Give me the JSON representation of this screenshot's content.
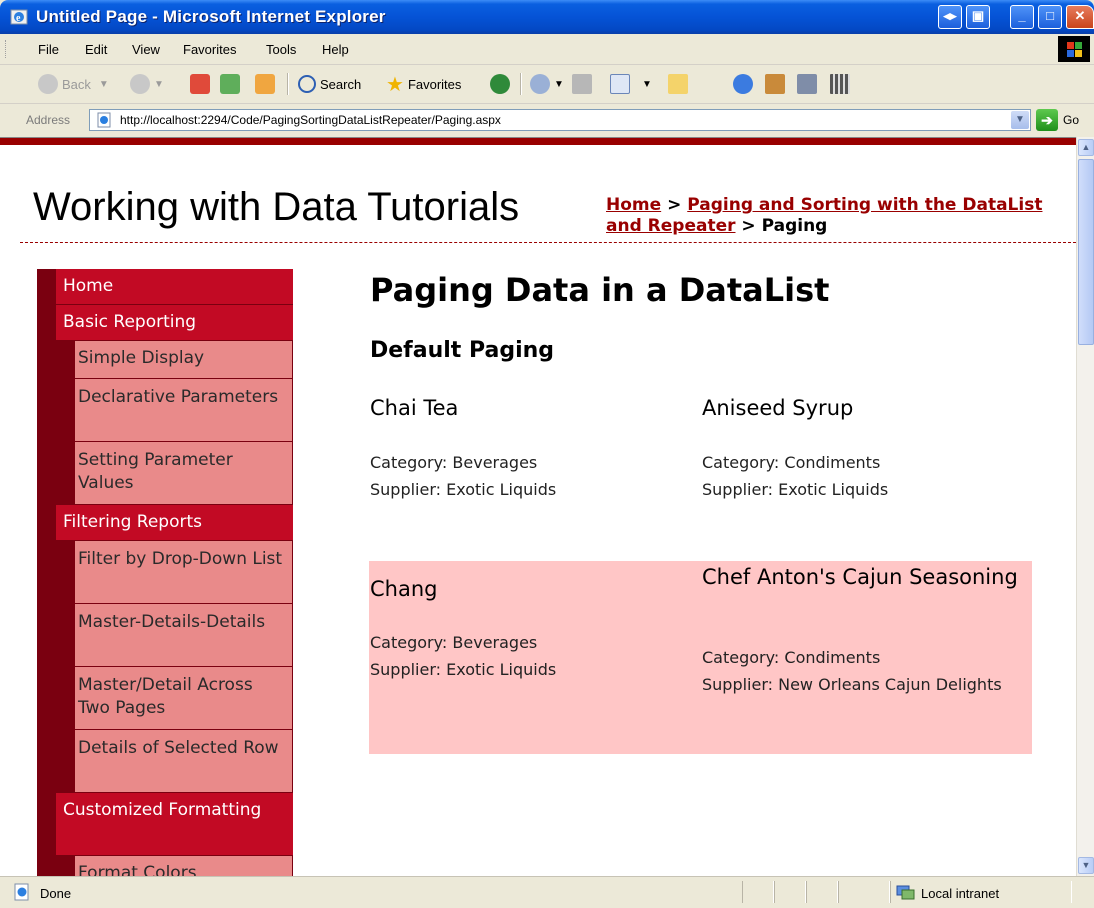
{
  "window": {
    "title": "Untitled Page - Microsoft Internet Explorer"
  },
  "menu": {
    "items": [
      "File",
      "Edit",
      "View",
      "Favorites",
      "Tools",
      "Help"
    ]
  },
  "toolbar": {
    "back_label": "Back",
    "search_label": "Search",
    "favorites_label": "Favorites"
  },
  "address": {
    "label": "Address",
    "url": "http://localhost:2294/Code/PagingSortingDataListRepeater/Paging.aspx",
    "go_label": "Go"
  },
  "site": {
    "title": "Working with Data Tutorials",
    "breadcrumb": {
      "home": "Home",
      "sep1": " > ",
      "section": "Paging and Sorting with the DataList and Repeater",
      "sep2": " > ",
      "current": "Paging"
    }
  },
  "sidebar": {
    "items": [
      {
        "label": "Home",
        "level": 0
      },
      {
        "label": "Basic Reporting",
        "level": 0
      },
      {
        "label": "Simple Display",
        "level": 1
      },
      {
        "label": "Declarative Parameters",
        "level": 1
      },
      {
        "label": "Setting Parameter Values",
        "level": 1
      },
      {
        "label": "Filtering Reports",
        "level": 0
      },
      {
        "label": "Filter by Drop-Down List",
        "level": 1
      },
      {
        "label": "Master-Details-Details",
        "level": 1
      },
      {
        "label": "Master/Detail Across Two Pages",
        "level": 1
      },
      {
        "label": "Details of Selected Row",
        "level": 1
      },
      {
        "label": "Customized Formatting",
        "level": 0
      },
      {
        "label": "Format Colors",
        "level": 1
      }
    ]
  },
  "main": {
    "heading": "Paging Data in a DataList",
    "subheading": "Default Paging",
    "products": [
      {
        "name": "Chai Tea",
        "category": "Category: Beverages",
        "supplier": "Supplier: Exotic Liquids"
      },
      {
        "name": "Aniseed Syrup",
        "category": "Category: Condiments",
        "supplier": "Supplier: Exotic Liquids"
      },
      {
        "name": "Chang",
        "category": "Category: Beverages",
        "supplier": "Supplier: Exotic Liquids"
      },
      {
        "name": "Chef Anton's Cajun Seasoning",
        "category": "Category: Condiments",
        "supplier": "Supplier: New Orleans Cajun Delights"
      }
    ],
    "alt_row_color": "#ffc6c6"
  },
  "status": {
    "text": "Done",
    "zone": "Local intranet"
  },
  "colors": {
    "brand": "#990000",
    "nav_top": "#c20a24",
    "nav_sub": "#e98a8a",
    "nav_dark": "#7a0010"
  }
}
